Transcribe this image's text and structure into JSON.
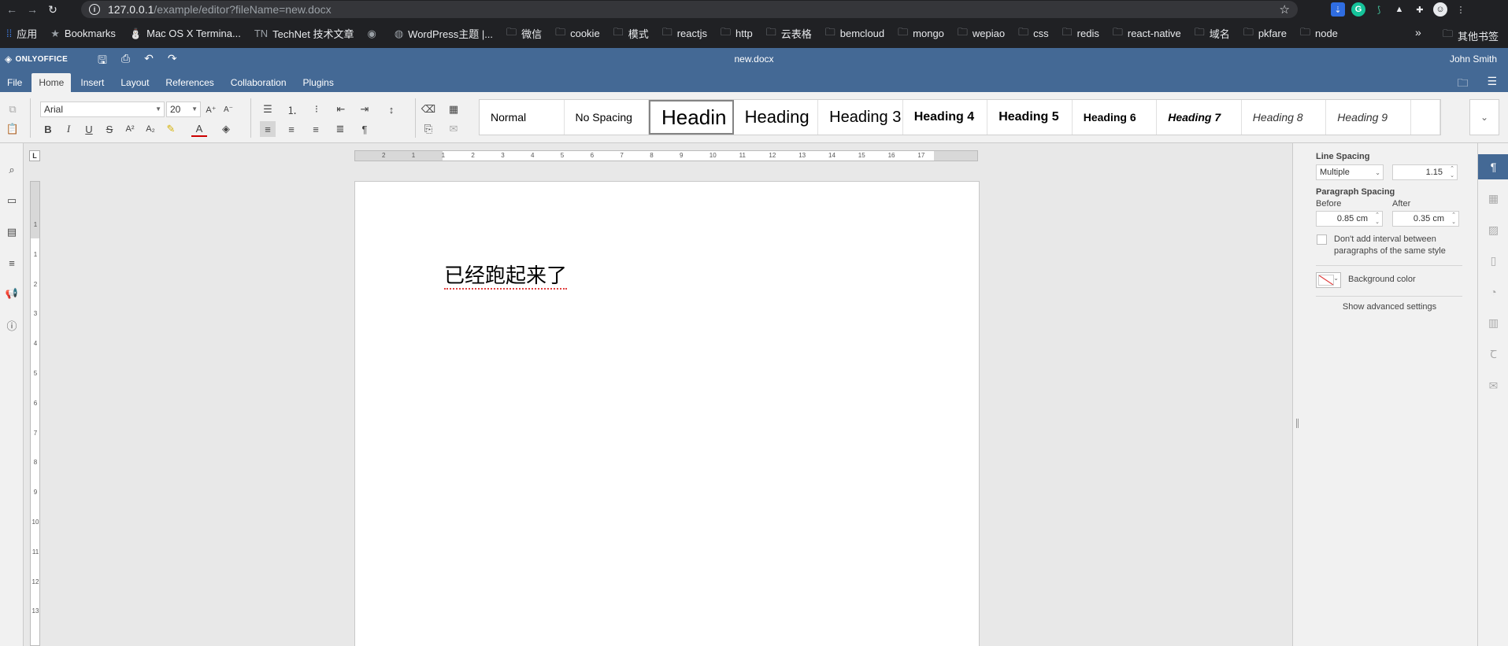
{
  "browser": {
    "url_host": "127.0.0.1",
    "url_path": "/example/editor?fileName=new.docx",
    "bookmarks": [
      {
        "label": "应用",
        "icon": "apps-icon"
      },
      {
        "label": "Bookmarks",
        "icon": "star-icon"
      },
      {
        "label": "Mac OS X Termina...",
        "icon": "user-icon"
      },
      {
        "label": "TechNet 技术文章",
        "icon": "tn-icon"
      },
      {
        "label": "",
        "icon": "globe-icon"
      },
      {
        "label": "WordPress主题 |...",
        "icon": "site-icon"
      },
      {
        "label": "微信",
        "icon": "folder-icon"
      },
      {
        "label": "cookie",
        "icon": "folder-icon"
      },
      {
        "label": "模式",
        "icon": "folder-icon"
      },
      {
        "label": "reactjs",
        "icon": "folder-icon"
      },
      {
        "label": "http",
        "icon": "folder-icon"
      },
      {
        "label": "云表格",
        "icon": "folder-icon"
      },
      {
        "label": "bemcloud",
        "icon": "folder-icon"
      },
      {
        "label": "mongo",
        "icon": "folder-icon"
      },
      {
        "label": "wepiao",
        "icon": "folder-icon"
      },
      {
        "label": "css",
        "icon": "folder-icon"
      },
      {
        "label": "redis",
        "icon": "folder-icon"
      },
      {
        "label": "react-native",
        "icon": "folder-icon"
      },
      {
        "label": "域名",
        "icon": "folder-icon"
      },
      {
        "label": "pkfare",
        "icon": "folder-icon"
      },
      {
        "label": "node",
        "icon": "folder-icon"
      }
    ],
    "bookmarks_more": "»",
    "other_bookmarks": "其他书签"
  },
  "app": {
    "logo": "ONLYOFFICE",
    "doc_name": "new.docx",
    "user": "John Smith",
    "tabs": [
      "File",
      "Home",
      "Insert",
      "Layout",
      "References",
      "Collaboration",
      "Plugins"
    ],
    "active_tab": "Home"
  },
  "toolbar": {
    "font_name": "Arial",
    "font_size": "20",
    "styles": [
      {
        "label": "Normal"
      },
      {
        "label": "No Spacing"
      },
      {
        "label": "Headin"
      },
      {
        "label": "Heading"
      },
      {
        "label": "Heading 3"
      },
      {
        "label": "Heading 4"
      },
      {
        "label": "Heading 5"
      },
      {
        "label": "Heading 6"
      },
      {
        "label": "Heading 7"
      },
      {
        "label": "Heading 8"
      },
      {
        "label": "Heading 9"
      },
      {
        "label": ""
      }
    ],
    "selected_style": "Headin"
  },
  "ruler": {
    "h_ticks": [
      "2",
      "1",
      "1",
      "2",
      "3",
      "4",
      "5",
      "6",
      "7",
      "8",
      "9",
      "10",
      "11",
      "12",
      "13",
      "14",
      "15",
      "16",
      "17"
    ],
    "v_ticks": [
      "1",
      "1",
      "2",
      "3",
      "4",
      "5",
      "6",
      "7",
      "8",
      "9",
      "10",
      "11",
      "12",
      "13"
    ]
  },
  "document": {
    "text": "已经跑起来了"
  },
  "paragraph_panel": {
    "line_spacing_label": "Line Spacing",
    "line_spacing_mode": "Multiple",
    "line_spacing_value": "1.15",
    "paragraph_spacing_label": "Paragraph Spacing",
    "before_label": "Before",
    "before_value": "0.85 cm",
    "after_label": "After",
    "after_value": "0.35 cm",
    "no_interval_label": "Don't add interval between paragraphs of the same style",
    "no_interval_checked": false,
    "background_color_label": "Background color",
    "advanced_link": "Show advanced settings"
  },
  "colors": {
    "header_blue": "#446995",
    "toolbar_bg": "#f1f1f1",
    "spellcheck_red": "#e04040"
  }
}
